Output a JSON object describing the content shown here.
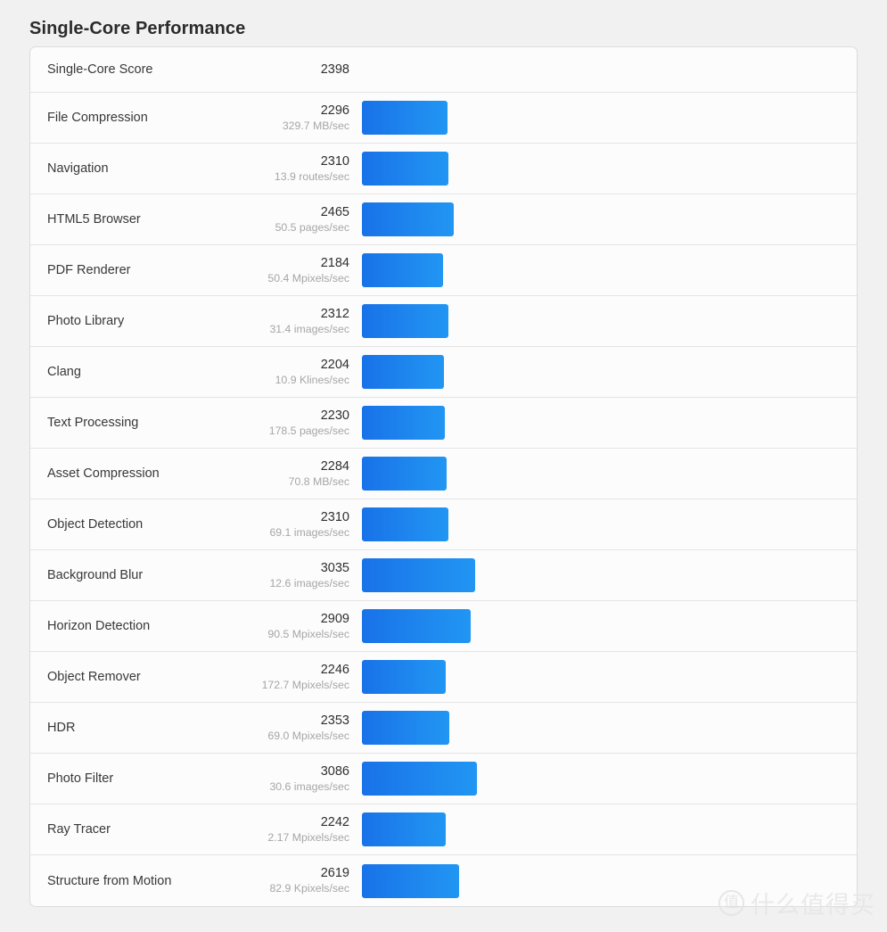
{
  "page": {
    "title": "Single-Core Performance",
    "accent_color": "#1a73e8",
    "background_color": "#f1f1f1",
    "card_background": "#fcfcfc"
  },
  "summary": {
    "label": "Single-Core Score",
    "score": "2398"
  },
  "watermark": {
    "logo_glyph": "值",
    "text": "什么值得买"
  },
  "chart_data": {
    "type": "bar",
    "title": "Single-Core Performance",
    "xlabel": "",
    "ylabel": "",
    "orientation": "horizontal",
    "summary_score": 2398,
    "max_value": 3086,
    "categories": [
      "File Compression",
      "Navigation",
      "HTML5 Browser",
      "PDF Renderer",
      "Photo Library",
      "Clang",
      "Text Processing",
      "Asset Compression",
      "Object Detection",
      "Background Blur",
      "Horizon Detection",
      "Object Remover",
      "HDR",
      "Photo Filter",
      "Ray Tracer",
      "Structure from Motion"
    ],
    "values": [
      2296,
      2310,
      2465,
      2184,
      2312,
      2204,
      2230,
      2284,
      2310,
      3035,
      2909,
      2246,
      2353,
      3086,
      2242,
      2619
    ],
    "rates": [
      "329.7 MB/sec",
      "13.9 routes/sec",
      "50.5 pages/sec",
      "50.4 Mpixels/sec",
      "31.4 images/sec",
      "10.9 Klines/sec",
      "178.5 pages/sec",
      "70.8 MB/sec",
      "69.1 images/sec",
      "12.6 images/sec",
      "90.5 Mpixels/sec",
      "172.7 Mpixels/sec",
      "69.0 Mpixels/sec",
      "30.6 images/sec",
      "2.17 Mpixels/sec",
      "82.9 Kpixels/sec"
    ]
  },
  "rows": [
    {
      "label": "File Compression",
      "score": "2296",
      "rate": "329.7 MB/sec"
    },
    {
      "label": "Navigation",
      "score": "2310",
      "rate": "13.9 routes/sec"
    },
    {
      "label": "HTML5 Browser",
      "score": "2465",
      "rate": "50.5 pages/sec"
    },
    {
      "label": "PDF Renderer",
      "score": "2184",
      "rate": "50.4 Mpixels/sec"
    },
    {
      "label": "Photo Library",
      "score": "2312",
      "rate": "31.4 images/sec"
    },
    {
      "label": "Clang",
      "score": "2204",
      "rate": "10.9 Klines/sec"
    },
    {
      "label": "Text Processing",
      "score": "2230",
      "rate": "178.5 pages/sec"
    },
    {
      "label": "Asset Compression",
      "score": "2284",
      "rate": "70.8 MB/sec"
    },
    {
      "label": "Object Detection",
      "score": "2310",
      "rate": "69.1 images/sec"
    },
    {
      "label": "Background Blur",
      "score": "3035",
      "rate": "12.6 images/sec"
    },
    {
      "label": "Horizon Detection",
      "score": "2909",
      "rate": "90.5 Mpixels/sec"
    },
    {
      "label": "Object Remover",
      "score": "2246",
      "rate": "172.7 Mpixels/sec"
    },
    {
      "label": "HDR",
      "score": "2353",
      "rate": "69.0 Mpixels/sec"
    },
    {
      "label": "Photo Filter",
      "score": "3086",
      "rate": "30.6 images/sec"
    },
    {
      "label": "Ray Tracer",
      "score": "2242",
      "rate": "2.17 Mpixels/sec"
    },
    {
      "label": "Structure from Motion",
      "score": "2619",
      "rate": "82.9 Kpixels/sec"
    }
  ]
}
